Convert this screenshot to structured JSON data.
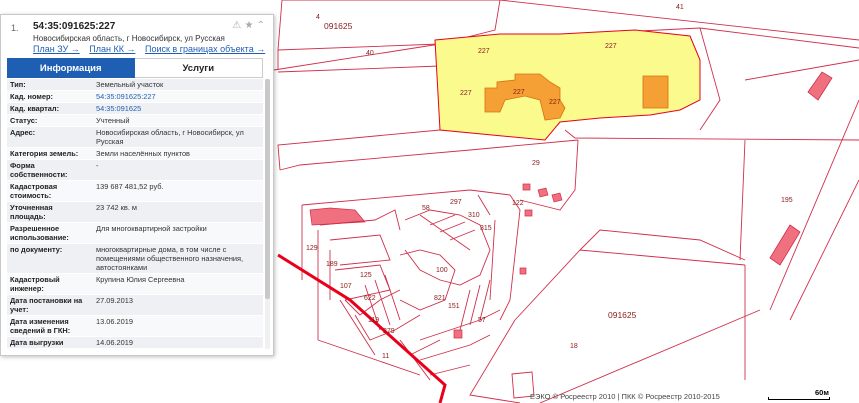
{
  "panel": {
    "number": "1.",
    "cadastral_number": "54:35:091625:227",
    "address_line": "Новосибирская область, г Новосибирск, ул Русская",
    "links": [
      "План ЗУ →",
      "План КК →",
      "Поиск в границах объекта →"
    ],
    "tabs": {
      "info": "Информация",
      "services": "Услуги"
    },
    "rows": [
      {
        "key": "Тип:",
        "value": "Земельный участок"
      },
      {
        "key": "Кад. номер:",
        "value": "54:35:091625:227"
      },
      {
        "key": "Кад. квартал:",
        "value": "54:35:091625"
      },
      {
        "key": "Статус:",
        "value": "Учтенный"
      },
      {
        "key": "Адрес:",
        "value": "Новосибирская область, г Новосибирск, ул Русская"
      },
      {
        "key": "Категория земель:",
        "value": "Земли населённых пунктов"
      },
      {
        "key": "Форма собственности:",
        "value": "-"
      },
      {
        "key": "Кадастровая стоимость:",
        "value": "139 687 481,52 руб."
      },
      {
        "key": "Уточненная площадь:",
        "value": "23 742 кв. м"
      },
      {
        "key": "Разрешенное использование:",
        "value": "Для многоквартирной застройки"
      },
      {
        "key": "по документу:",
        "value": "многоквартирные дома, в том числе с помещениями общественного назначения, автостоянками"
      },
      {
        "key": "Кадастровый инженер:",
        "value": "Крупина Юлия Сергеевна"
      },
      {
        "key": "Дата постановки на учет:",
        "value": "27.09.2013"
      },
      {
        "key": "Дата изменения сведений в ГКН:",
        "value": "13.06.2019"
      },
      {
        "key": "Дата выгрузки",
        "value": "14.06.2019"
      }
    ]
  },
  "map": {
    "labels": {
      "l4": "4",
      "q1": "091625",
      "l40": "40",
      "l227a": "227",
      "l227b": "227",
      "l227c": "227",
      "l227d": "227",
      "l227e": "227",
      "l41": "41",
      "l29": "29",
      "l195": "195",
      "l18": "18",
      "q2": "091625",
      "l11": "11",
      "l100": "100",
      "l107": "107",
      "l125": "125",
      "l189": "189",
      "l129": "129",
      "l297": "297",
      "l310": "310",
      "l122": "122",
      "l58": "58",
      "l315": "315",
      "l57": "57",
      "l151": "151",
      "l821": "821",
      "l279": "279",
      "l119": "119",
      "l622": "622"
    },
    "colors": {
      "selected_fill": "#fbfa8c",
      "building_fill": "#f5a035",
      "border_red": "#e8001a",
      "line": "#d0304a"
    }
  },
  "footer": {
    "copyright": "ЕЭКО © Росреестр 2010 | ПКК © Росреестр 2010-2015",
    "scale": "60м"
  }
}
